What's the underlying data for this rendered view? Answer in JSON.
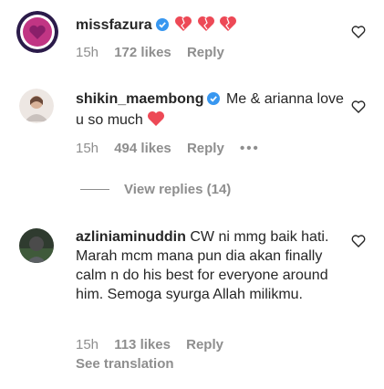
{
  "comments": [
    {
      "username": "missfazura",
      "verified": true,
      "text": "",
      "emoji_hearts": 3,
      "time": "15h",
      "likes": "172 likes",
      "reply": "Reply"
    },
    {
      "username": "shikin_maembong",
      "verified": true,
      "text": "Me & arianna love u so much",
      "time": "15h",
      "likes": "494 likes",
      "reply": "Reply",
      "more": "•••",
      "view_replies": "View replies (14)"
    },
    {
      "username": "azliniaminuddin",
      "verified": false,
      "text": "CW ni mmg baik hati. Marah mcm mana pun dia akan finally calm n do his best for everyone around him. Semoga syurga Allah milikmu.",
      "time": "15h",
      "likes": "113 likes",
      "reply": "Reply",
      "see_translation": "See translation"
    }
  ],
  "colors": {
    "text": "#262626",
    "muted": "#8e8e8e",
    "verified": "#3897f0",
    "heart": "#ed4956"
  }
}
